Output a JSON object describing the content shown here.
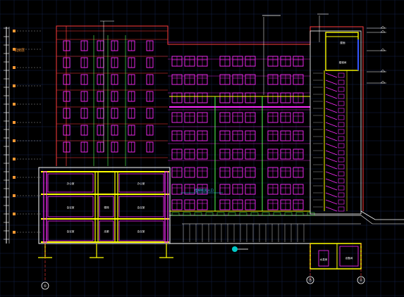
{
  "drawing": {
    "background": "#000000",
    "grid_color": "#14234a",
    "colors": {
      "outline": "#ff3b3b",
      "window": "#ff2bff",
      "highlight": "#ffff00",
      "elevation": "#ffffff",
      "frame": "#00c8c8",
      "accent": "#55ff55",
      "label_orange": "#ff9933",
      "label_cyan": "#33ccff"
    },
    "annotations": {
      "orange_label": "机房层",
      "cyan_note": "电梯机房入口",
      "room_upper_left": "办公室",
      "room_upper_right": "办公室",
      "room_mid_left": "会议室",
      "room_mid_right": "会议室",
      "room_low_left": "会议室",
      "room_low_right": "会议室",
      "room_core_1": "楼梯",
      "room_core_2": "走廊",
      "room_base_1": "水泵房",
      "room_base_2": "设备间",
      "stair_label": "楼梯间",
      "right_top_label": "屋面"
    },
    "axis_markers": [
      "①",
      "⑮",
      "Ⓐ"
    ],
    "icons": [
      "axis-bubble-icon",
      "section-symbol-icon",
      "elevation-marker-icon"
    ]
  }
}
